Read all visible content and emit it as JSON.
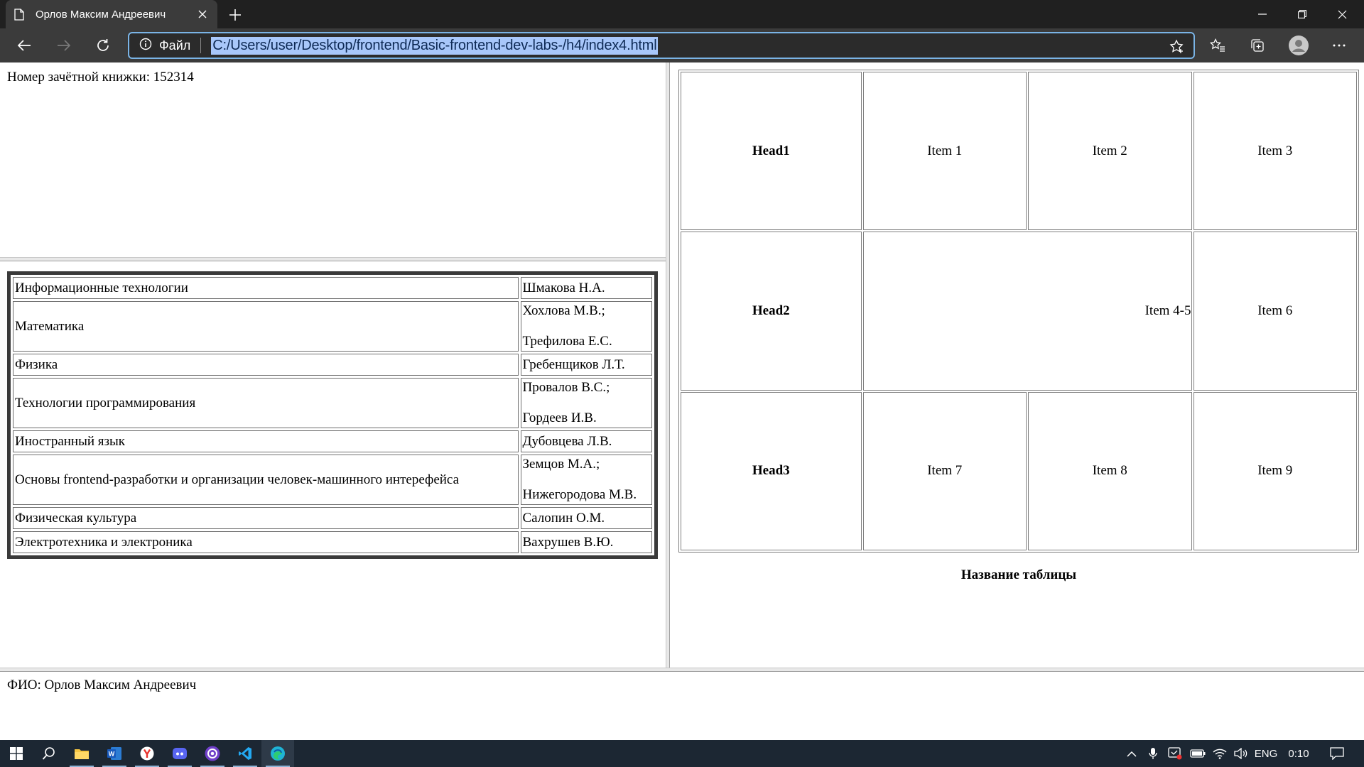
{
  "browser": {
    "tab_title": "Орлов Максим Андреевич",
    "address_label": "Файл",
    "url": "C:/Users/user/Desktop/frontend/Basic-frontend-dev-labs-/h4/index4.html"
  },
  "frames": {
    "top_left": {
      "record_book": "Номер зачётной книжки: 152314"
    },
    "subjects": [
      {
        "name": "Информационные технологии",
        "teachers": [
          "Шмакова Н.А."
        ]
      },
      {
        "name": "Математика",
        "teachers": [
          "Хохлова М.В.;",
          "Трефилова Е.С."
        ]
      },
      {
        "name": "Физика",
        "teachers": [
          "Гребенщиков Л.Т."
        ]
      },
      {
        "name": "Технологии программирования",
        "teachers": [
          "Провалов В.С.;",
          "Гордеев И.В."
        ]
      },
      {
        "name": "Иностранный язык",
        "teachers": [
          "Дубовцева Л.В."
        ]
      },
      {
        "name": "Основы frontend-разработки и организации человек-машинного интерефейса",
        "teachers": [
          "Земцов М.А.;",
          "Нижегородова М.В."
        ]
      },
      {
        "name": "Физическая культура",
        "teachers": [
          "Салопин О.М."
        ]
      },
      {
        "name": "Электротехника и электроника",
        "teachers": [
          "Вахрушев В.Ю."
        ]
      }
    ],
    "grid": {
      "row1": {
        "head": "Head1",
        "c1": "Item 1",
        "c2": "Item 2",
        "c3": "Item 3"
      },
      "row2": {
        "head": "Head2",
        "span": "Item 4-5",
        "c3": "Item 6"
      },
      "row3": {
        "head": "Head3",
        "c1": "Item 7",
        "c2": "Item 8",
        "c3": "Item 9"
      },
      "caption": "Название таблицы"
    },
    "bottom": {
      "fio": "ФИО: Орлов Максим Андреевич"
    }
  },
  "taskbar": {
    "language": "ENG",
    "time": "0:10",
    "apps": [
      "windows-start",
      "search",
      "file-explorer",
      "word",
      "yandex-browser",
      "discord",
      "obs",
      "vscode",
      "edge"
    ]
  },
  "colors": {
    "titlebar": "#202020",
    "toolbar": "#3b3b3b",
    "url_highlight": "#a8c7fa",
    "address_border": "#7ab4e6",
    "taskbar": "#1c2733"
  }
}
